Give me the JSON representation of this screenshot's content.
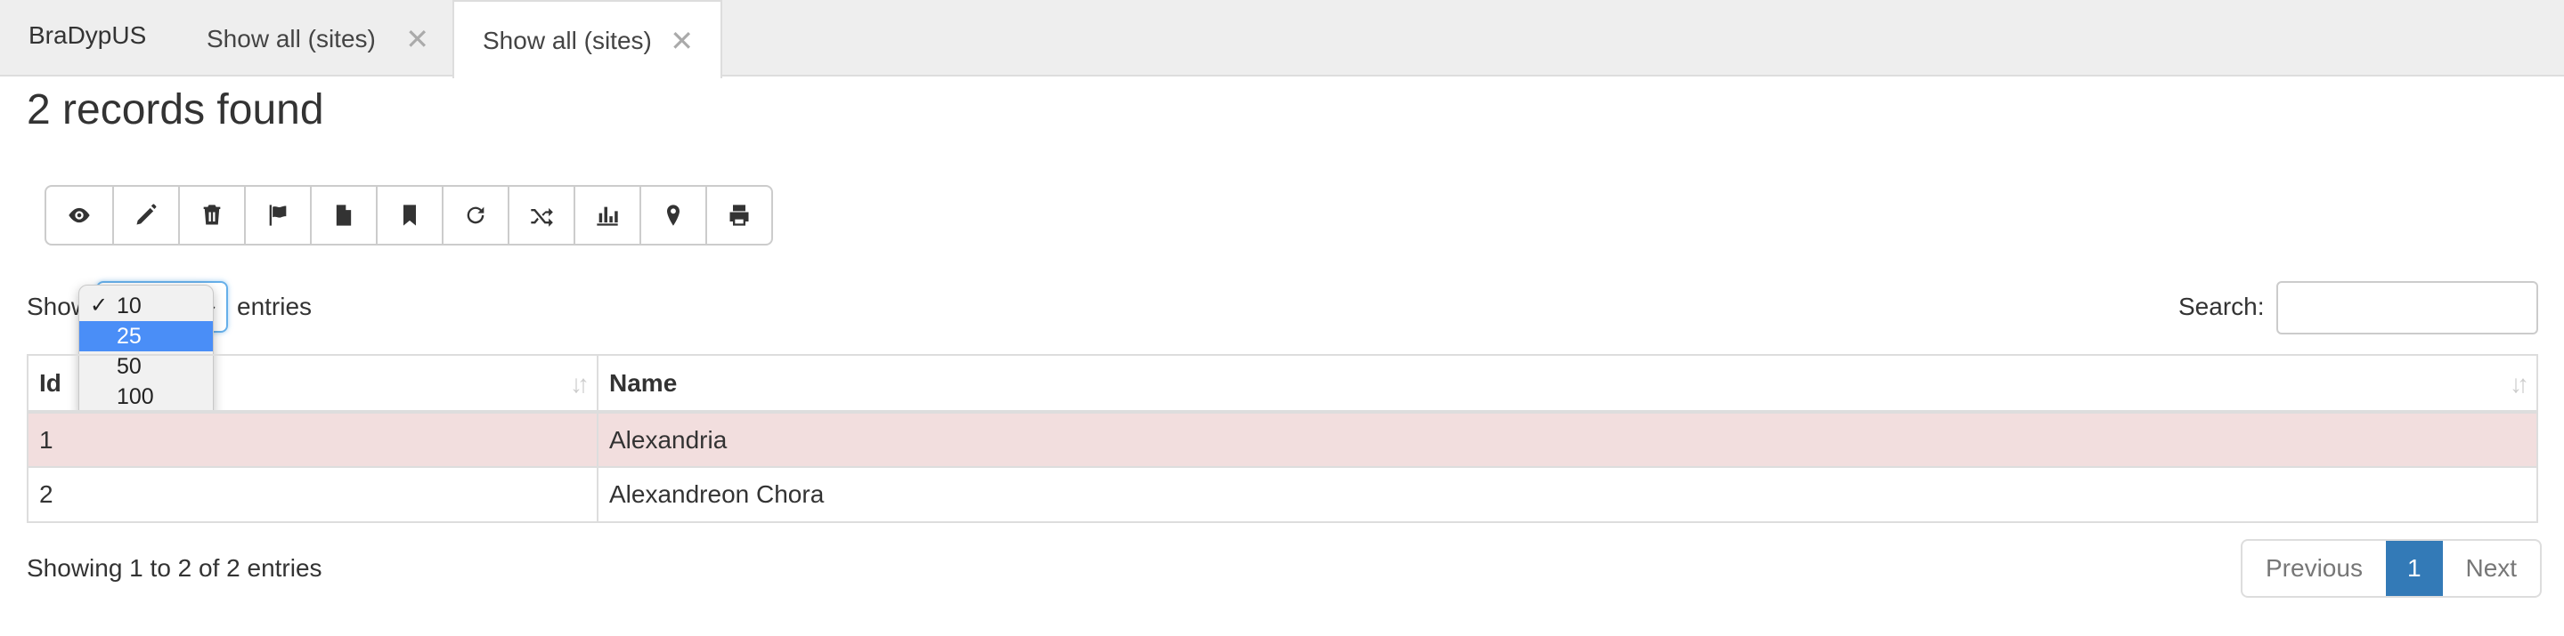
{
  "app": {
    "brand": "BraDypUS"
  },
  "tabs": [
    {
      "label": "Show all (sites)",
      "close": "✕"
    },
    {
      "label": "Show all (sites)",
      "close": "✕"
    }
  ],
  "heading": "2 records found",
  "toolbar": {
    "icons": [
      "eye-icon",
      "pencil-icon",
      "trash-icon",
      "flag-icon",
      "file-icon",
      "bookmark-icon",
      "refresh-icon",
      "random-icon",
      "bar-chart-icon",
      "map-marker-icon",
      "print-icon"
    ]
  },
  "length": {
    "show_label": "Show",
    "entries_label": "entries",
    "options": [
      "10",
      "25",
      "50",
      "100"
    ],
    "checked": "10",
    "highlighted": "25",
    "check_glyph": "✓"
  },
  "search": {
    "label": "Search:",
    "value": ""
  },
  "table": {
    "headers": [
      "Id",
      "Name"
    ],
    "rows": [
      {
        "id": "1",
        "name": "Alexandria"
      },
      {
        "id": "2",
        "name": "Alexandreon Chora"
      }
    ]
  },
  "info": "Showing 1 to 2 of 2 entries",
  "pagination": {
    "previous": "Previous",
    "page": "1",
    "next": "Next"
  },
  "colors": {
    "accent": "#337ab7",
    "row_highlight": "#f2dede",
    "dropdown_selected": "#4a8ef7"
  }
}
